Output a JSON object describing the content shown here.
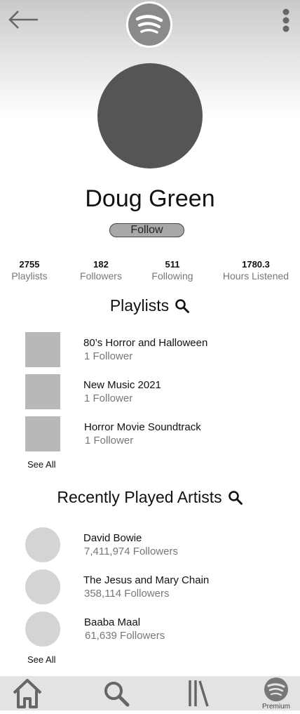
{
  "header": {
    "back_icon": "back-arrow-icon",
    "logo_icon": "spotify-logo-icon",
    "menu_icon": "more-vertical-icon"
  },
  "profile": {
    "name": "Doug Green",
    "follow_label": "Follow",
    "stats": [
      {
        "value": "2755",
        "label": "Playlists"
      },
      {
        "value": "182",
        "label": "Followers"
      },
      {
        "value": "511",
        "label": "Following"
      },
      {
        "value": "1780.3",
        "label": "Hours Listened"
      }
    ]
  },
  "playlists": {
    "title": "Playlists",
    "search_icon": "search-icon",
    "items": [
      {
        "title": "80’s Horror and Halloween",
        "subtitle": "1 Follower"
      },
      {
        "title": "New Music 2021",
        "subtitle": "1 Follower"
      },
      {
        "title": "Horror Movie Soundtrack",
        "subtitle": "1 Follower"
      }
    ],
    "see_all": "See All"
  },
  "artists": {
    "title": "Recently Played Artists",
    "search_icon": "search-icon",
    "items": [
      {
        "title": "David Bowie",
        "subtitle": "7,411,974 Followers"
      },
      {
        "title": "The Jesus and Mary Chain",
        "subtitle": "358,114 Followers"
      },
      {
        "title": "Baaba Maal",
        "subtitle": "61,639 Followers"
      }
    ],
    "see_all": "See All"
  },
  "bottom_nav": {
    "home_icon": "home-icon",
    "search_icon": "search-icon",
    "library_icon": "library-icon",
    "premium_icon": "spotify-logo-icon",
    "premium_label": "Premium"
  },
  "colors": {
    "avatar": "#555555",
    "playlist_thumb": "#b8b8b8",
    "artist_thumb": "#d4d4d4",
    "follow_button": "#a8a8a8",
    "nav_bar": "#e3e3e3"
  }
}
